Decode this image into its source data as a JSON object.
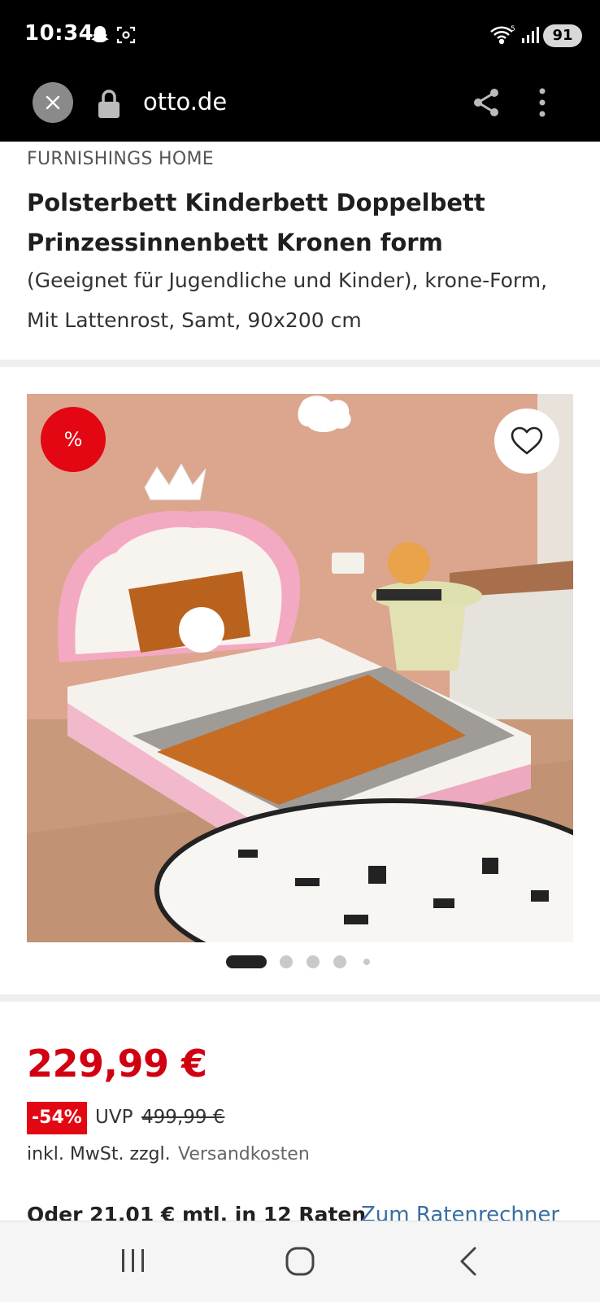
{
  "status_bar": {
    "time": "10:34",
    "battery": "91",
    "icons": [
      "snapchat-icon",
      "screenshot-icon",
      "wifi-icon",
      "signal-icon"
    ]
  },
  "browser": {
    "url": "otto.de",
    "icons": [
      "close-icon",
      "lock-icon",
      "share-icon",
      "more-vert-icon"
    ]
  },
  "product": {
    "brand": "FURNISHINGS HOME",
    "title": "Polsterbett Kinderbett Doppelbett Prinzessinnenbett Kronen form",
    "subtitle": "(Geeignet für Jugendliche und Kinder), krone-Form, Mit Lattenrost, Samt, 90x200 cm"
  },
  "gallery": {
    "discount_badge": "%",
    "slide_count": 5,
    "active_slide": 1,
    "icons": [
      "heart-icon"
    ]
  },
  "price": {
    "current": "229,99 €",
    "discount": "-54%",
    "uvp_label": "UVP",
    "uvp_price": "499,99 €",
    "vat_text": "inkl. MwSt. zzgl.",
    "shipping_link": "Versandkosten",
    "installment_text": "Oder 21,01 € mtl. in 12 Raten",
    "installment_link": "Zum Ratenrechner"
  },
  "colors": {
    "accent_red": "#e30613",
    "price_red": "#d10011",
    "link_blue": "#3a6ea5"
  },
  "nav": {
    "icons": [
      "recent-apps-icon",
      "home-icon",
      "back-icon"
    ]
  }
}
